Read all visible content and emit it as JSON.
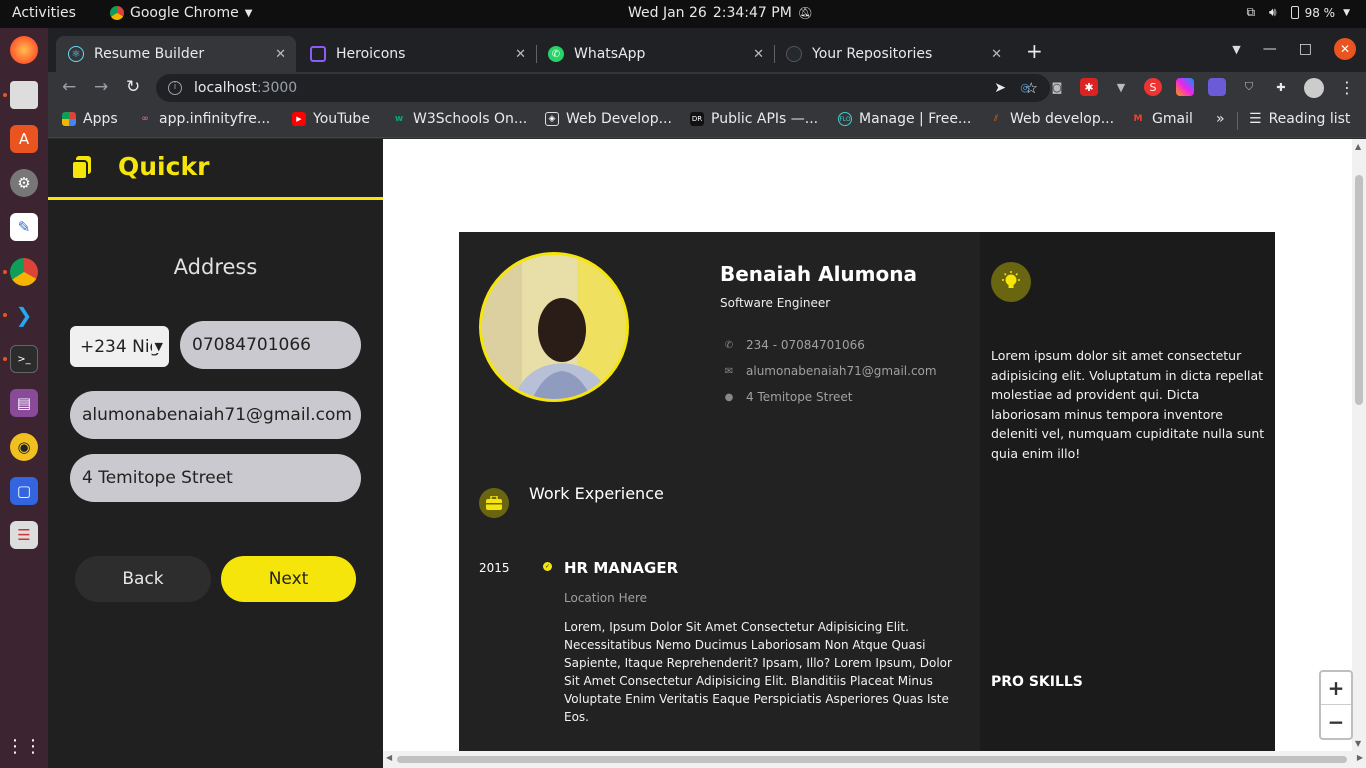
{
  "system_bar": {
    "activities": "Activities",
    "app_name": "Google Chrome",
    "date": "Wed Jan 26",
    "time": "2:34:47 PM",
    "battery": "98 %"
  },
  "tabs": [
    {
      "title": "Resume Builder",
      "active": true
    },
    {
      "title": "Heroicons",
      "active": false
    },
    {
      "title": "WhatsApp",
      "active": false
    },
    {
      "title": "Your Repositories",
      "active": false
    }
  ],
  "address_bar": {
    "host": "localhost",
    "port": ":3000"
  },
  "bookmarks": [
    {
      "label": "Apps",
      "icon": "apps-grid-icon"
    },
    {
      "label": "app.infinityfre...",
      "icon": "infinityfree-icon"
    },
    {
      "label": "YouTube",
      "icon": "youtube-icon"
    },
    {
      "label": "W3Schools On...",
      "icon": "w3schools-icon"
    },
    {
      "label": "Web Develop...",
      "icon": "webdev-icon"
    },
    {
      "label": "Public APIs —...",
      "icon": "publicapis-icon"
    },
    {
      "label": "Manage | Free...",
      "icon": "freenom-icon"
    },
    {
      "label": "Web develop...",
      "icon": "mdn-icon"
    },
    {
      "label": "Gmail",
      "icon": "gmail-icon"
    }
  ],
  "bookmarks_more": "»",
  "reading_list": "Reading list",
  "sidebar": {
    "brand": "Quickr",
    "section_title": "Address",
    "country_code": "+234 Nig",
    "phone": "07084701066",
    "email": "alumonabenaiah71@gmail.com",
    "address": "4 Temitope Street",
    "back_label": "Back",
    "next_label": "Next"
  },
  "resume": {
    "name": "Benaiah Alumona",
    "title": "Software Engineer",
    "phone": "234 - 07084701066",
    "email": "alumonabenaiah71@gmail.com",
    "address": "4 Temitope Street",
    "about": "Lorem ipsum dolor sit amet consectetur adipisicing elit. Voluptatum in dicta repellat molestiae ad provident qui. Dicta laboriosam minus tempora inventore deleniti vel, numquam cupiditate nulla sunt quia enim illo!",
    "work_heading": "Work Experience",
    "job": {
      "year": "2015",
      "role": "HR MANAGER",
      "location": "Location Here",
      "description": "Lorem, Ipsum Dolor Sit Amet Consectetur Adipisicing Elit. Necessitatibus Nemo Ducimus Laboriosam Non Atque Quasi Sapiente, Itaque Reprehenderit? Ipsam, Illo? Lorem Ipsum, Dolor Sit Amet Consectetur Adipisicing Elit. Blanditiis Placeat Minus Voluptate Enim Veritatis Eaque Perspiciatis Asperiores Quas Iste Eos."
    },
    "skills_heading": "PRO SKILLS"
  },
  "zoom": {
    "in": "+",
    "out": "−"
  },
  "colors": {
    "accent": "#f5e50a",
    "sidebar_bg": "#202020",
    "resume_bg": "#222222"
  }
}
